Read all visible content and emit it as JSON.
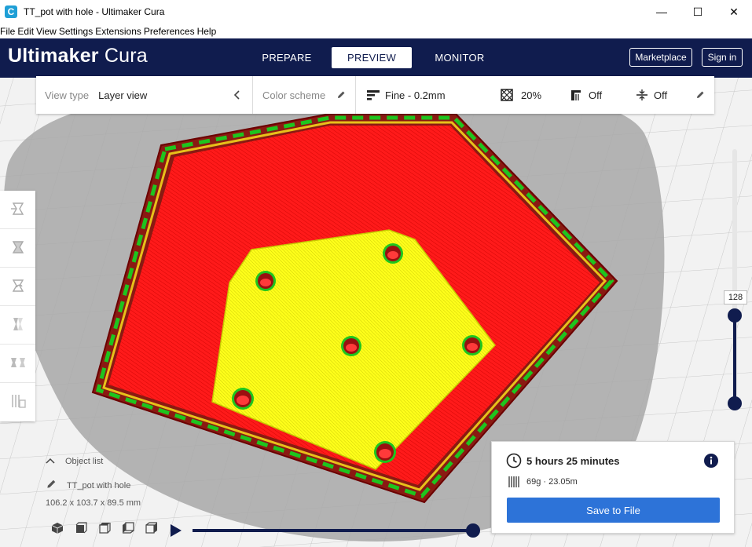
{
  "window": {
    "title": "TT_pot with hole - Ultimaker Cura",
    "app_icon": "C",
    "minimize": "—",
    "maximize": "☐",
    "close": "✕"
  },
  "menu": [
    "File",
    "Edit",
    "View",
    "Settings",
    "Extensions",
    "Preferences",
    "Help"
  ],
  "header": {
    "logo_bold": "Ultimaker",
    "logo_light": "Cura",
    "tabs": [
      {
        "label": "PREPARE",
        "active": false
      },
      {
        "label": "PREVIEW",
        "active": true
      },
      {
        "label": "MONITOR",
        "active": false
      }
    ],
    "marketplace": "Marketplace",
    "sign_in": "Sign in"
  },
  "settings_bar": {
    "view_type_label": "View type",
    "view_type_value": "Layer view",
    "color_scheme_label": "Color scheme",
    "profile": "Fine - 0.2mm",
    "infill": "20%",
    "support": "Off",
    "adhesion": "Off"
  },
  "layer_slider": {
    "current": "128"
  },
  "object": {
    "list_label": "Object list",
    "name": "TT_pot with hole",
    "dimensions": "106.2 x 103.7 x 89.5 mm"
  },
  "print": {
    "time": "5 hours 25 minutes",
    "material": "69g · 23.05m",
    "save_label": "Save to File"
  },
  "colors": {
    "header": "#101c4e",
    "wall_red": "#ff1a1a",
    "infill_yellow": "#ffff1a",
    "skin_green": "#1ec51e",
    "save_blue": "#2d73d8"
  }
}
